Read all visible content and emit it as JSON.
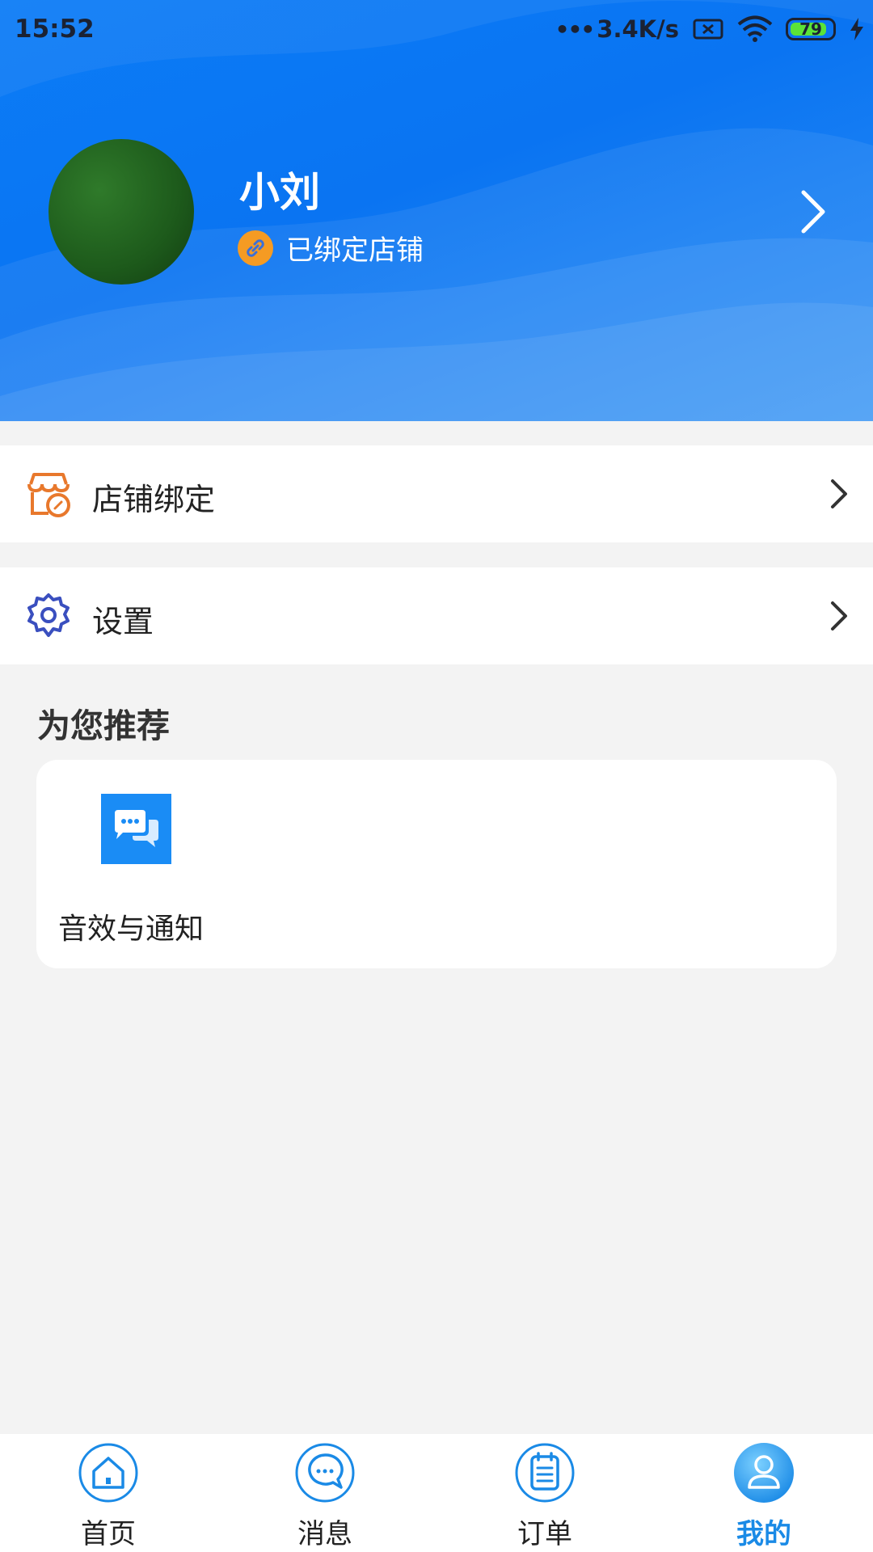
{
  "status_bar": {
    "time": "15:52",
    "network_speed": "3.4K/s",
    "battery_level": "79",
    "icons": [
      "signal-dots-icon",
      "sim-card-x-icon",
      "wifi-icon",
      "battery-icon",
      "charging-bolt-icon"
    ]
  },
  "profile": {
    "name": "小刘",
    "bind_status": "已绑定店铺",
    "icons": [
      "avatar",
      "link-icon",
      "chevron-right-icon"
    ]
  },
  "menu": {
    "items": [
      {
        "label": "店铺绑定",
        "icon": "store-link-icon",
        "icon_color": "#e8782c"
      },
      {
        "label": "设置",
        "icon": "gear-icon",
        "icon_color": "#3a4fbf"
      }
    ]
  },
  "recommend": {
    "title": "为您推荐",
    "items": [
      {
        "label": "音效与通知",
        "icon": "chat-bubbles-icon",
        "icon_bg": "#1a8cf5"
      }
    ]
  },
  "tabbar": {
    "active_color": "#1a8ae6",
    "tabs": [
      {
        "label": "首页",
        "icon": "home-icon"
      },
      {
        "label": "消息",
        "icon": "message-icon"
      },
      {
        "label": "订单",
        "icon": "order-clipboard-icon"
      },
      {
        "label": "我的",
        "icon": "user-icon",
        "active": true
      }
    ]
  }
}
